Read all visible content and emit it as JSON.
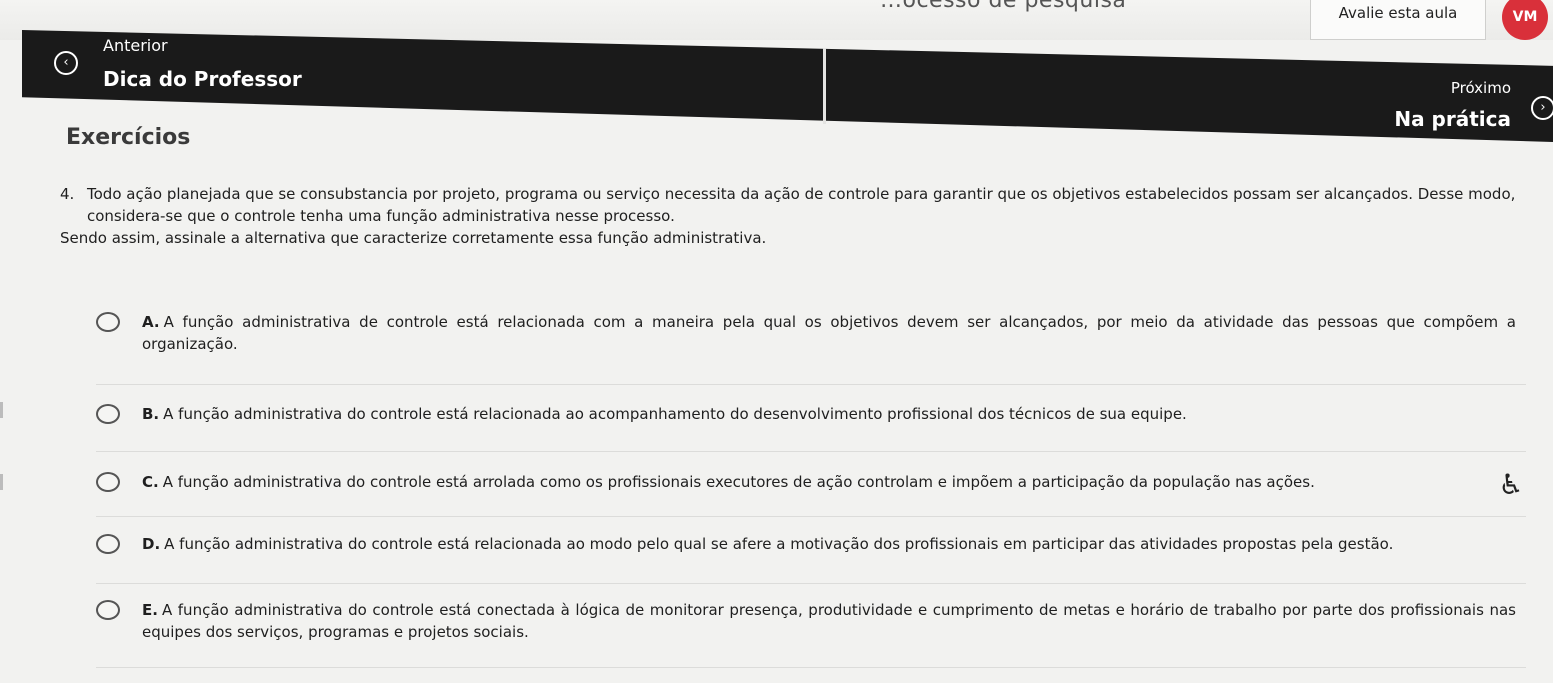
{
  "top": {
    "cut_text": "…ocesso de pesquisa",
    "rate_label": "Avalie esta aula",
    "avatar_initials": "VM"
  },
  "nav": {
    "previous_small": "Anterior",
    "previous_title": "Dica do Professor",
    "next_small": "Próximo",
    "next_title": "Na prática",
    "previous_icon": "chevron-left-circle-icon",
    "next_icon": "chevron-right-circle-icon"
  },
  "section": {
    "title": "Exercícios"
  },
  "question": {
    "number": "4.",
    "text": "Todo ação planejada que se consubstancia por projeto, programa ou serviço necessita da ação de controle para garantir que os objetivos estabelecidos possam ser alcançados. Desse modo, considera-se que o controle tenha uma função administrativa nesse processo.",
    "instruction": "Sendo assim, assinale a alternativa que caracterize corretamente essa função administrativa."
  },
  "options": [
    {
      "letter": "A.",
      "text": "A função administrativa de controle está relacionada com a maneira pela qual os objetivos devem ser alcançados, por meio da atividade das pessoas que compõem a organização."
    },
    {
      "letter": "B.",
      "text": "A função administrativa do controle está relacionada ao acompanhamento do desenvolvimento profissional dos técnicos de sua equipe."
    },
    {
      "letter": "C.",
      "text": "A função administrativa do controle está arrolada como os profissionais executores de ação controlam e impõem a participação da população nas ações."
    },
    {
      "letter": "D.",
      "text": "A função administrativa do controle está relacionada ao modo pelo qual se afere a motivação dos profissionais em participar das atividades propostas pela gestão."
    },
    {
      "letter": "E.",
      "text": "A função administrativa do controle está conectada à lógica de monitorar presença, produtividade e cumprimento de metas e horário de trabalho por parte dos profissionais nas equipes dos serviços, programas e projetos sociais."
    }
  ],
  "accessibility_icon": "accessibility-icon"
}
